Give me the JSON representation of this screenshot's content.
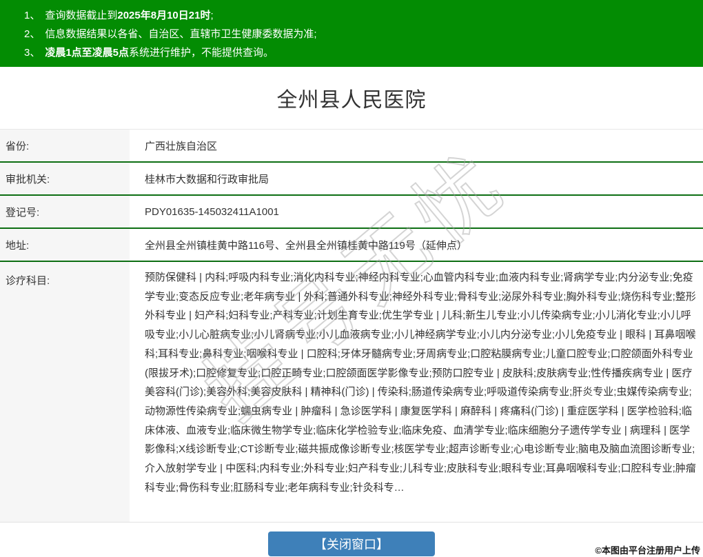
{
  "notices": [
    {
      "num": "1、",
      "pre": "查询数据截止到",
      "bold": "2025年8月10日21时",
      "post": ";"
    },
    {
      "num": "2、",
      "pre": "信息数据结果以各省、自治区、直辖市卫生健康委数据为准;",
      "bold": "",
      "post": ""
    },
    {
      "num": "3、",
      "pre": "",
      "bold": "凌晨1点至凌晨5点",
      "post": "系统进行维护，不能提供查询。"
    }
  ],
  "title": "全州县人民医院",
  "table": {
    "rows": [
      {
        "label": "省份:",
        "value": "广西壮族自治区"
      },
      {
        "label": "审批机关:",
        "value": "桂林市大数据和行政审批局"
      },
      {
        "label": "登记号:",
        "value": "PDY01635-145032411A1001"
      },
      {
        "label": "地址:",
        "value": "全州县全州镇桂黄中路116号、全州县全州镇桂黄中路119号（延伸点）"
      },
      {
        "label": "诊疗科目:",
        "value": "预防保健科 | 内科;呼吸内科专业;消化内科专业;神经内科专业;心血管内科专业;血液内科专业;肾病学专业;内分泌专业;免疫学专业;变态反应专业;老年病专业 | 外科;普通外科专业;神经外科专业;骨科专业;泌尿外科专业;胸外科专业;烧伤科专业;整形外科专业 | 妇产科;妇科专业;产科专业;计划生育专业;优生学专业 | 儿科;新生儿专业;小儿传染病专业;小儿消化专业;小儿呼吸专业;小儿心脏病专业;小儿肾病专业;小儿血液病专业;小儿神经病学专业;小儿内分泌专业;小儿免疫专业 | 眼科 | 耳鼻咽喉科;耳科专业;鼻科专业;咽喉科专业 | 口腔科;牙体牙髓病专业;牙周病专业;口腔粘膜病专业;儿童口腔专业;口腔颌面外科专业(限拔牙术);口腔修复专业;口腔正畸专业;口腔颌面医学影像专业;预防口腔专业 | 皮肤科;皮肤病专业;性传播疾病专业 | 医疗美容科(门诊);美容外科;美容皮肤科 | 精神科(门诊) | 传染科;肠道传染病专业;呼吸道传染病专业;肝炎专业;虫媒传染病专业;动物源性传染病专业;蠕虫病专业 | 肿瘤科 | 急诊医学科 | 康复医学科 | 麻醉科 | 疼痛科(门诊) | 重症医学科 | 医学检验科;临床体液、血液专业;临床微生物学专业;临床化学检验专业;临床免疫、血清学专业;临床细胞分子遗传学专业 | 病理科 | 医学影像科;X线诊断专业;CT诊断专业;磁共振成像诊断专业;核医学专业;超声诊断专业;心电诊断专业;脑电及脑血流图诊断专业;介入放射学专业 | 中医科;内科专业;外科专业;妇产科专业;儿科专业;皮肤科专业;眼科专业;耳鼻咽喉科专业;口腔科专业;肿瘤科专业;骨伤科专业;肛肠科专业;老年病科专业;针灸科专…"
      }
    ]
  },
  "close_button": {
    "label": "【关闭窗口】"
  },
  "footer": {
    "note": "©本图由平台注册用户上传"
  },
  "watermark": {
    "text": "挂号无忧"
  },
  "colors": {
    "header_green": "#038c03",
    "separator_green": "#0c6e12",
    "button_blue": "#3e80b9",
    "label_bg": "#f6f6f6",
    "text": "#333333"
  }
}
